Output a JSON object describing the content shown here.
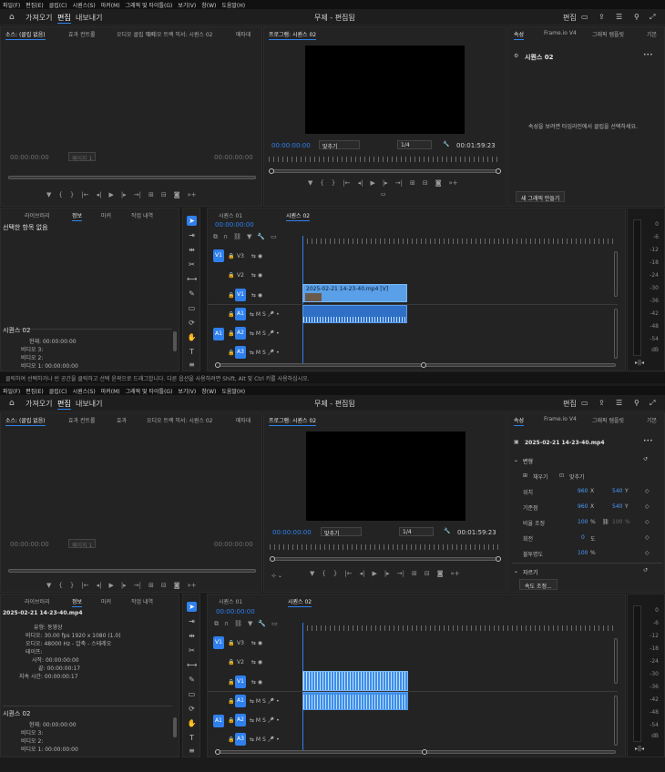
{
  "menu": [
    "파일(F)",
    "편집(E)",
    "클립(C)",
    "시퀀스(S)",
    "마커(M)",
    "그래픽 및 타이틀(G)",
    "보기(V)",
    "창(W)",
    "도움말(H)"
  ],
  "workspace": {
    "tabs": [
      "가져오기",
      "편집",
      "내보내기"
    ],
    "active": "편집",
    "title": "무제 - 편집됨",
    "right_label": "편집"
  },
  "shot1": {
    "source": {
      "tabs": [
        "소스: (클립 없음)",
        "효과 컨트롤",
        "오디오 클립 믹서",
        "오디오 트랙 믹서: 시퀀스 02",
        "메타데"
      ],
      "tc_left": "00:00:00:00",
      "tc_right": "00:00:00:00",
      "page": "페이지 1"
    },
    "program": {
      "tab": "프로그램: 시퀀스 02",
      "tc": "00:00:00:00",
      "fit": "맞추기",
      "res": "1/4",
      "duration": "00:01:59:23"
    },
    "properties": {
      "tabs": [
        "속성",
        "Frame.io V4",
        "그래픽 템플릿",
        "기본"
      ],
      "title": "시퀀스 02",
      "hint": "속성을 보려면 타임라인에서 클립을 선택하세요.",
      "new_graphic": "새 그래픽 만들기"
    },
    "info": {
      "tabs": [
        "라이브러리",
        "정보",
        "마커",
        "작업 내역"
      ],
      "heading": "선택한 항목 없음",
      "seq": "시퀀스 02",
      "lines": [
        "현재: 00:00:00:00",
        "비디오 3:",
        "비디오 2:",
        "비디오 1: 00:00:00:00"
      ]
    },
    "timeline": {
      "tabs": [
        "시퀀스 01",
        "시퀀스 02"
      ],
      "tc": "00:00:00:00",
      "clip_name": "2025-02-21 14-23-40.mp4 [V]"
    },
    "status": "클릭하여 선택하거나 빈 공간을 클릭하고 선택 윤곽으로 드래그합니다. 다른 옵션을 사용하려면 Shift, Alt 및 Ctrl 키를 사용하십시오."
  },
  "shot2": {
    "source": {
      "tabs": [
        "소스: (클립 없음)",
        "효과 컨트롤",
        "효과",
        "오디오 트랙 믹서: 시퀀스 02",
        "메타데"
      ],
      "tc_left": "00:00:00:00",
      "tc_right": "00:00:00:00",
      "page": "페이지 1"
    },
    "program": {
      "tab": "프로그램: 시퀀스 02",
      "tc": "00:00:00:00",
      "fit": "맞추기",
      "res": "1/4",
      "duration": "00:01:59:23"
    },
    "properties": {
      "tabs": [
        "속성",
        "Frame.io V4",
        "그래픽 템플릿",
        "기본"
      ],
      "title": "2025-02-21 14-23-40.mp4",
      "section_transform": "변형",
      "fill": "채우기",
      "fit": "맞추기",
      "rows": [
        {
          "k": "위치",
          "a": "960",
          "au": "X",
          "b": "540",
          "bu": "Y"
        },
        {
          "k": "기준점",
          "a": "960",
          "au": "X",
          "b": "540",
          "bu": "Y"
        },
        {
          "k": "비율 조정",
          "a": "100",
          "au": "%",
          "b": "100",
          "bu": "%"
        },
        {
          "k": "회전",
          "a": "0",
          "au": "도",
          "b": "",
          "bu": ""
        },
        {
          "k": "불투명도",
          "a": "100",
          "au": "%",
          "b": "",
          "bu": ""
        }
      ],
      "section_speed": "자르기",
      "speed_btn": "속도 조정..."
    },
    "info": {
      "tabs": [
        "라이브러리",
        "정보",
        "마커",
        "작업 내역"
      ],
      "heading": "2025-02-21 14-23-40.mp4",
      "lines": [
        "유형: 동영상",
        "비디오: 30.00 fps 1920 x 1080 (1.0)",
        "오디오: 48000 Hz - 압축 - 스테레오",
        "테이프:",
        "시작: 00:00:00:00",
        "끝: 00:00:00:17",
        "지속 시간: 00:00:00:17"
      ],
      "seq": "시퀀스 02",
      "lines2": [
        "현재: 00:00:00:00",
        "비디오 3:",
        "비디오 2:",
        "비디오 1: 00:00:00:00"
      ]
    },
    "timeline": {
      "tabs": [
        "시퀀스 01",
        "시퀀스 02"
      ],
      "tc": "00:00:00:00"
    }
  },
  "tracks": [
    "V3",
    "V2",
    "V1",
    "A1",
    "A2",
    "A3"
  ],
  "meter_db": [
    "0",
    "-6",
    "-12",
    "-18",
    "-24",
    "-30",
    "-36",
    "-42",
    "-48",
    "-54",
    "dB"
  ]
}
